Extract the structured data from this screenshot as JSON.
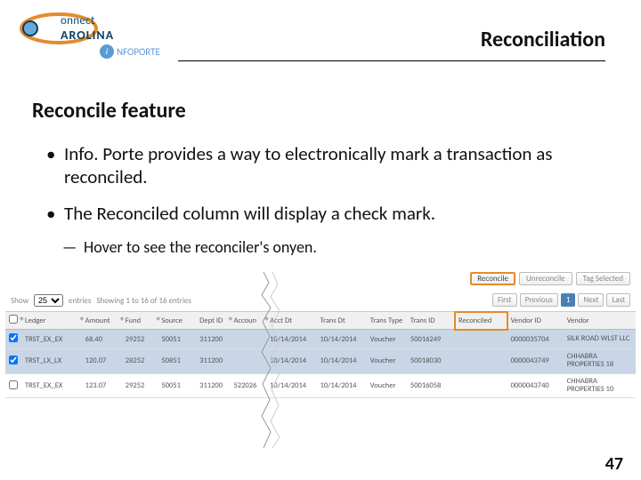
{
  "logo": {
    "line1": "onnect",
    "line2": "AROLINA",
    "sub": "NFOPORTE"
  },
  "title": "Reconciliation",
  "subhead": "Reconcile feature",
  "bullets": {
    "b1": "Info. Porte provides a way to electronically mark a transaction as reconciled.",
    "b2": "The Reconciled column will display a check mark.",
    "sub1": "Hover to see the reconciler's onyen."
  },
  "toolbar": {
    "reconcile": "Reconcile",
    "unreconcile": "Unreconcile",
    "tag": "Tag Selected"
  },
  "pager": {
    "show": "Show",
    "page_size": "25",
    "entries_label": "entries",
    "showing": "Showing 1 to 16 of 16 entries",
    "first": "First",
    "prev": "Previous",
    "current": "1",
    "next": "Next",
    "last": "Last"
  },
  "columns": {
    "chk": "",
    "ledger": "Ledger",
    "amount": "Amount",
    "fund": "Fund",
    "source": "Source",
    "dept": "Dept ID",
    "account": "Accoun",
    "acctdt": "Acct Dt",
    "transdt": "Trans Dt",
    "transtype": "Trans Type",
    "transid": "Trans ID",
    "reconciled": "Reconciled",
    "vendorid": "Vendor ID",
    "vendor": "Vendor"
  },
  "rows": [
    {
      "sel": true,
      "ledger": "TRST_EX_EX",
      "amount": "68.40",
      "fund": "29252",
      "source": "50051",
      "dept": "311200",
      "account": "",
      "acctdt": "10/14/2014",
      "transdt": "10/14/2014",
      "transtype": "Voucher",
      "transid": "50016249",
      "reconciled": "",
      "vendorid": "0000035704",
      "vendor": "SILK ROAD WLST LLC"
    },
    {
      "sel": true,
      "ledger": "TRST_LX_LX",
      "amount": "120.07",
      "fund": "28252",
      "source": "50851",
      "dept": "311200",
      "account": "",
      "acctdt": "10/14/2014",
      "transdt": "10/14/2014",
      "transtype": "Voucher",
      "transid": "50018030",
      "reconciled": "",
      "vendorid": "0000043749",
      "vendor": "CHHABRA PROPERTIES 18"
    },
    {
      "sel": false,
      "ledger": "TRST_EX_EX",
      "amount": "123.07",
      "fund": "29252",
      "source": "50051",
      "dept": "311200",
      "account": "522026",
      "acctdt": "10/14/2014",
      "transdt": "10/14/2014",
      "transtype": "Voucher",
      "transid": "50016058",
      "reconciled": "",
      "vendorid": "0000043740",
      "vendor": "CHHABRA PROPERTIES 10"
    }
  ],
  "page_number": "47"
}
